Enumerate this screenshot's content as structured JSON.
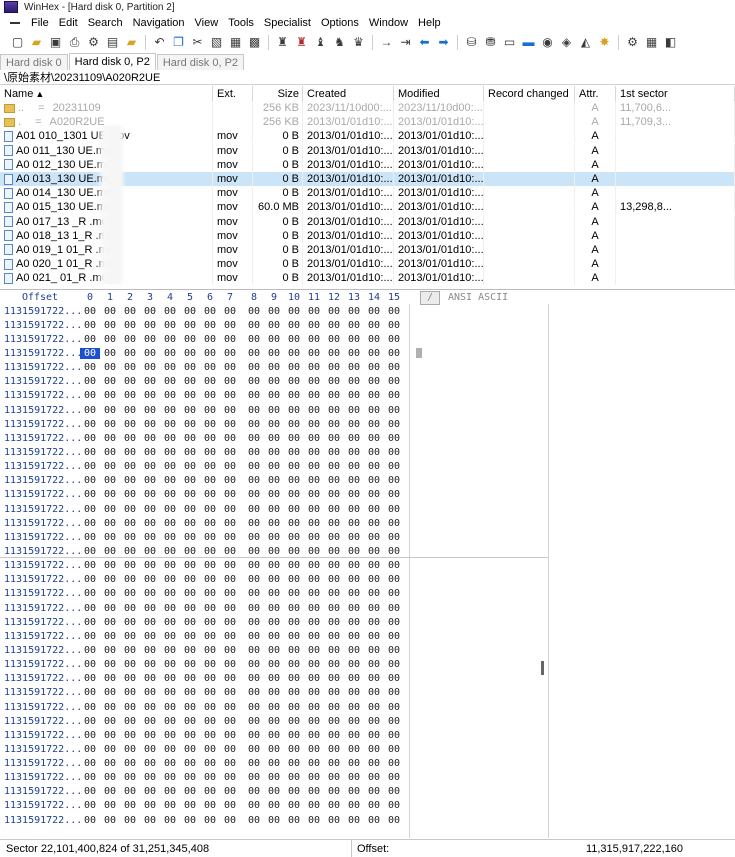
{
  "window": {
    "title": "WinHex - [Hard disk 0, Partition 2]"
  },
  "menu": [
    "File",
    "Edit",
    "Search",
    "Navigation",
    "View",
    "Tools",
    "Specialist",
    "Options",
    "Window",
    "Help"
  ],
  "tabs": [
    "Hard disk 0",
    "Hard disk 0, P2",
    "Hard disk 0, P2"
  ],
  "active_tab_index": 1,
  "path": "\\原始素材\\20231109\\A020R2UE",
  "file_list": {
    "headers": [
      "Name",
      "Ext.",
      "Size",
      "Created",
      "Modified",
      "Record changed",
      "Attr.",
      "1st sector"
    ],
    "sort_indicator": "▲",
    "rows": [
      {
        "name": "..",
        "mark": "=",
        "label": "20231109",
        "ext": "",
        "size": "256 KB",
        "created": "2023/11/10d00:...",
        "modified": "2023/11/10d00:...",
        "record": "",
        "attr": "A",
        "sector": "11,700,6...",
        "dim": true,
        "folder": true
      },
      {
        "name": ".",
        "mark": "=",
        "label": "A020R2UE",
        "ext": "",
        "size": "256 KB",
        "created": "2013/01/01d10:...",
        "modified": "2013/01/01d10:...",
        "record": "",
        "attr": "A",
        "sector": "11,709,3...",
        "dim": true,
        "folder": true
      },
      {
        "name": "A01   010_1301   UE.mov",
        "ext": "mov",
        "size": "0 B",
        "created": "2013/01/01d10:...",
        "modified": "2013/01/01d10:...",
        "record": "",
        "attr": "A",
        "sector": ""
      },
      {
        "name": "A0    011_130     UE.mov",
        "ext": "mov",
        "size": "0 B",
        "created": "2013/01/01d10:...",
        "modified": "2013/01/01d10:...",
        "record": "",
        "attr": "A",
        "sector": ""
      },
      {
        "name": "A0    012_130     UE.mov",
        "ext": "mov",
        "size": "0 B",
        "created": "2013/01/01d10:...",
        "modified": "2013/01/01d10:...",
        "record": "",
        "attr": "A",
        "sector": ""
      },
      {
        "name": "A0    013_130     UE.mov",
        "ext": "mov",
        "size": "0 B",
        "created": "2013/01/01d10:...",
        "modified": "2013/01/01d10:...",
        "record": "",
        "attr": "A",
        "sector": "",
        "selected": true
      },
      {
        "name": "A0    014_130     UE.mov",
        "ext": "mov",
        "size": "0 B",
        "created": "2013/01/01d10:...",
        "modified": "2013/01/01d10:...",
        "record": "",
        "attr": "A",
        "sector": ""
      },
      {
        "name": "A0    015_130     UE.mov",
        "ext": "mov",
        "size": "60.0 MB",
        "created": "2013/01/01d10:...",
        "modified": "2013/01/01d10:...",
        "record": "",
        "attr": "A",
        "sector": "13,298,8..."
      },
      {
        "name": "A0    017_13    _R  .mov",
        "ext": "mov",
        "size": "0 B",
        "created": "2013/01/01d10:...",
        "modified": "2013/01/01d10:...",
        "record": "",
        "attr": "A",
        "sector": ""
      },
      {
        "name": "A0    018_13    1_R  .mov",
        "ext": "mov",
        "size": "0 B",
        "created": "2013/01/01d10:...",
        "modified": "2013/01/01d10:...",
        "record": "",
        "attr": "A",
        "sector": ""
      },
      {
        "name": "A0    019_1    01_R  .mov",
        "ext": "mov",
        "size": "0 B",
        "created": "2013/01/01d10:...",
        "modified": "2013/01/01d10:...",
        "record": "",
        "attr": "A",
        "sector": ""
      },
      {
        "name": "A0    020_1    01_R  .mov",
        "ext": "mov",
        "size": "0 B",
        "created": "2013/01/01d10:...",
        "modified": "2013/01/01d10:...",
        "record": "",
        "attr": "A",
        "sector": ""
      },
      {
        "name": "A0    021_   01_R  .mov",
        "ext": "mov",
        "size": "0 B",
        "created": "2013/01/01d10:...",
        "modified": "2013/01/01d10:...",
        "record": "",
        "attr": "A",
        "sector": ""
      }
    ]
  },
  "hex": {
    "offset_label": "Offset",
    "column_labels": [
      "0",
      "1",
      "2",
      "3",
      "4",
      "5",
      "6",
      "7",
      "8",
      "9",
      "10",
      "11",
      "12",
      "13",
      "14",
      "15"
    ],
    "text_header": "ANSI ASCII",
    "row_offset_text": "1131591722...",
    "byte_text": "00",
    "row_count": 37,
    "cursor": {
      "row": 3,
      "col": 0
    }
  },
  "status": {
    "sector": "Sector 22,101,400,824 of 31,251,345,408",
    "offset_label": "Offset:",
    "offset_value": "11,315,917,222,160"
  }
}
